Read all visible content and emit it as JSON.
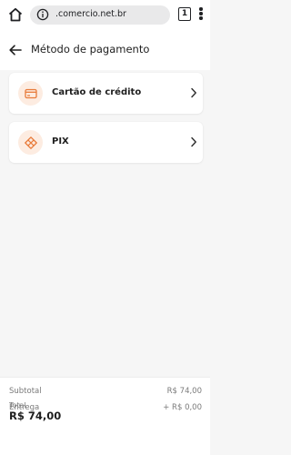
{
  "browser": {
    "url": ".comercio.net.br",
    "tab_count": "1"
  },
  "header": {
    "title": "Método de pagamento"
  },
  "payment_methods": [
    {
      "label": "Cartão de crédito",
      "icon": "credit-card-icon"
    },
    {
      "label": "PIX",
      "icon": "pix-icon"
    }
  ],
  "summary": {
    "subtotal_label": "Subtotal",
    "subtotal_value": "R$ 74,00",
    "delivery_label": "Entrega",
    "delivery_value": "+ R$ 0,00",
    "total_label": "Total",
    "total_value": "R$ 74,00"
  },
  "colors": {
    "accent": "#e87b3a",
    "icon_bg": "#fdece1",
    "page_bg": "#f6f6f6"
  }
}
